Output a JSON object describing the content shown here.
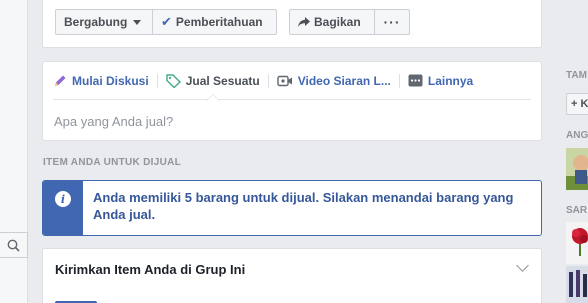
{
  "header": {
    "join_label": "Bergabung",
    "notif_label": "Pemberitahuan",
    "share_label": "Bagikan"
  },
  "composer": {
    "tabs": [
      {
        "label": "Mulai Diskusi",
        "icon": "pencil-icon"
      },
      {
        "label": "Jual Sesuatu",
        "icon": "tag-icon"
      },
      {
        "label": "Video Siaran L...",
        "icon": "video-camera-icon"
      },
      {
        "label": "Lainnya",
        "icon": "more-icon"
      }
    ],
    "placeholder": "Apa yang Anda jual?"
  },
  "section": {
    "label": "ITEM ANDA UNTUK DIJUAL"
  },
  "notice": {
    "text": "Anda memiliki 5 barang untuk dijual. Silakan menandai barang yang Anda jual."
  },
  "send_card": {
    "title": "Kirimkan Item Anda di Grup Ini"
  },
  "right_col": {
    "label_1": "TAM",
    "button": "+ K",
    "label_2": "ANG",
    "label_3": "SAR"
  },
  "colors": {
    "accent": "#4267b2",
    "link": "#365899",
    "background": "#e9ebee"
  }
}
